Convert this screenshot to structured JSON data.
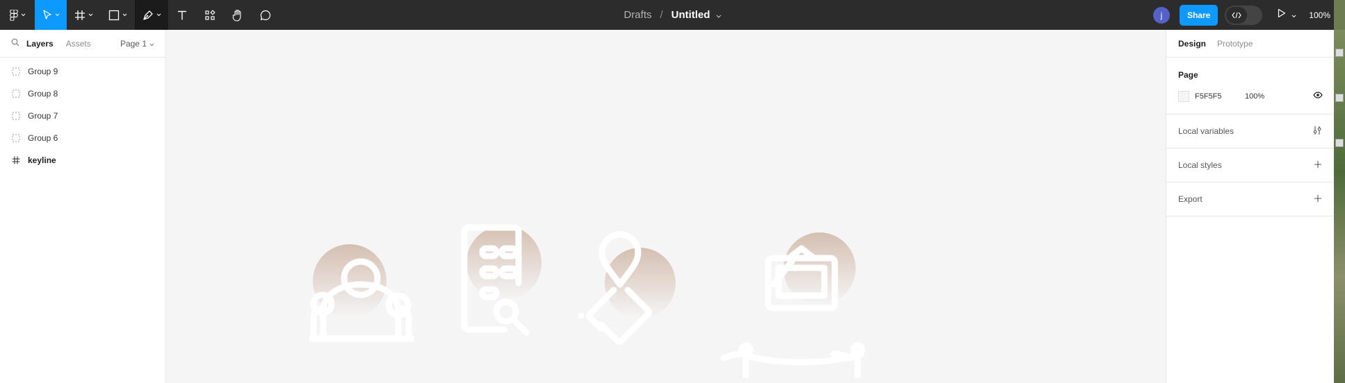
{
  "toolbar": {
    "breadcrumb": "Drafts",
    "separator": "/",
    "title": "Untitled",
    "avatar_initial": "j",
    "share_label": "Share",
    "zoom": "100%"
  },
  "left_panel": {
    "tabs": [
      {
        "label": "Layers"
      },
      {
        "label": "Assets"
      }
    ],
    "page_selector": "Page 1",
    "layers": [
      {
        "label": "Group 9",
        "type": "group"
      },
      {
        "label": "Group 8",
        "type": "group"
      },
      {
        "label": "Group 7",
        "type": "group"
      },
      {
        "label": "Group 6",
        "type": "group"
      },
      {
        "label": "keyline",
        "type": "frame"
      }
    ]
  },
  "right_panel": {
    "tabs": [
      {
        "label": "Design"
      },
      {
        "label": "Prototype"
      }
    ],
    "page": {
      "heading": "Page",
      "fill_hex": "F5F5F5",
      "fill_opacity": "100%"
    },
    "sections": [
      {
        "label": "Local variables"
      },
      {
        "label": "Local styles"
      },
      {
        "label": "Export"
      }
    ]
  },
  "colors": {
    "toolbar_bg": "#2c2c2c",
    "accent": "#0d99ff",
    "canvas_bg": "#f5f5f5",
    "icon_circle": "#d9c4b8"
  }
}
